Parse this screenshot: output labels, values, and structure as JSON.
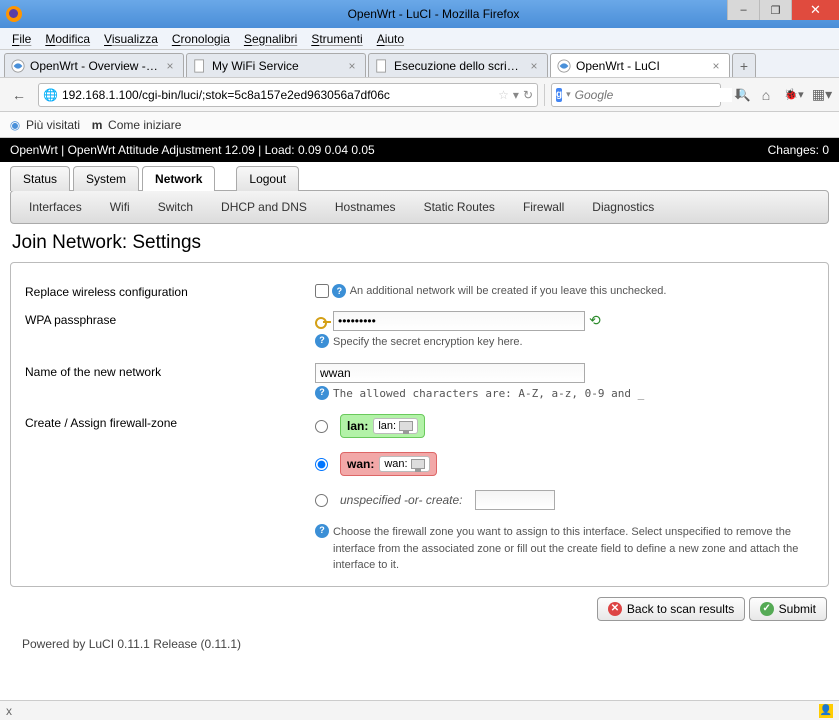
{
  "window": {
    "title": "OpenWrt - LuCI - Mozilla Firefox",
    "minimize": "–",
    "maximize": "❐",
    "close": "✕"
  },
  "menubar": [
    "File",
    "Modifica",
    "Visualizza",
    "Cronologia",
    "Segnalibri",
    "Strumenti",
    "Aiuto"
  ],
  "tabs": [
    {
      "label": "OpenWrt - Overview - LuCI",
      "active": false
    },
    {
      "label": "My WiFi Service",
      "active": false
    },
    {
      "label": "Esecuzione dello script di c...",
      "active": false
    },
    {
      "label": "OpenWrt - LuCI",
      "active": true
    }
  ],
  "nav": {
    "back": "←",
    "url": "192.168.1.100/cgi-bin/luci/;stok=5c8a157e2ed963056a7df06c",
    "search_placeholder": "Google"
  },
  "bookmarks": [
    {
      "label": "Più visitati"
    },
    {
      "label": "Come iniziare"
    }
  ],
  "owrt_header": {
    "left": "OpenWrt | OpenWrt Attitude Adjustment 12.09 | Load: 0.09 0.04 0.05",
    "right": "Changes: 0"
  },
  "main_tabs": [
    {
      "label": "Status",
      "active": false
    },
    {
      "label": "System",
      "active": false
    },
    {
      "label": "Network",
      "active": true
    },
    {
      "label": "Logout",
      "active": false,
      "logout": true
    }
  ],
  "sub_tabs": [
    "Interfaces",
    "Wifi",
    "Switch",
    "DHCP and DNS",
    "Hostnames",
    "Static Routes",
    "Firewall",
    "Diagnostics"
  ],
  "page_title": "Join Network: Settings",
  "form": {
    "replace": {
      "label": "Replace wireless configuration",
      "help": "An additional network will be created if you leave this unchecked."
    },
    "pass": {
      "label": "WPA passphrase",
      "value": "•••••••••",
      "help": "Specify the secret encryption key here."
    },
    "netname": {
      "label": "Name of the new network",
      "value": "wwan",
      "help": "The allowed characters are: A-Z, a-z, 0-9 and _"
    },
    "zone": {
      "label": "Create / Assign firewall-zone",
      "lan": {
        "name": "lan:",
        "iface": "lan:"
      },
      "wan": {
        "name": "wan:",
        "iface": "wan:"
      },
      "unspec": "unspecified -or- create:",
      "help": "Choose the firewall zone you want to assign to this interface. Select unspecified to remove the interface from the associated zone or fill out the create field to define a new zone and attach the interface to it."
    }
  },
  "buttons": {
    "back": "Back to scan results",
    "submit": "Submit"
  },
  "footer": "Powered by LuCI 0.11.1 Release (0.11.1)",
  "statusbar_x": "x"
}
